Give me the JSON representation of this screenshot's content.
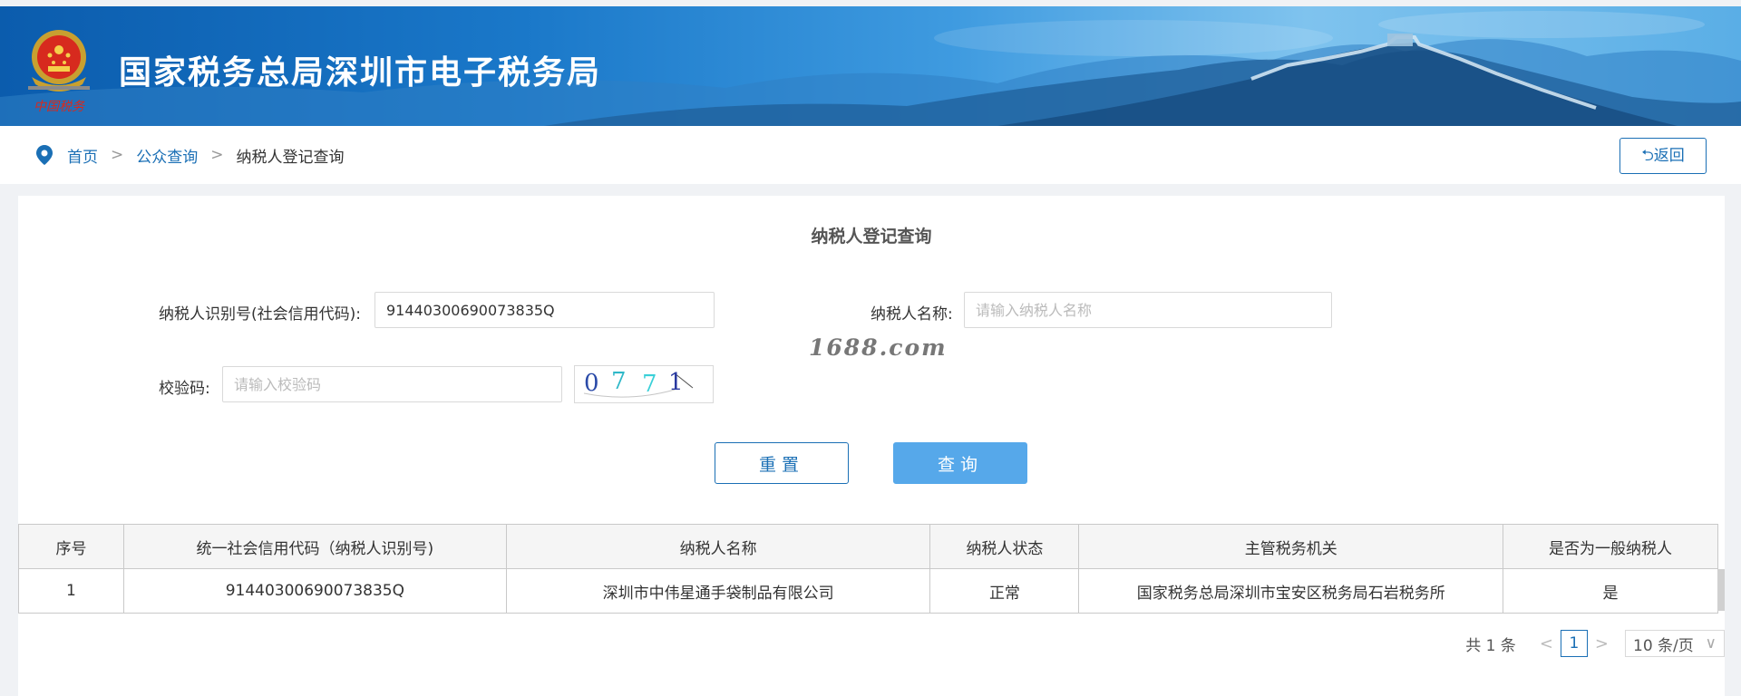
{
  "header": {
    "site_title": "国家税务总局深圳市电子税务局",
    "emblem_text": "中国税务",
    "colors": {
      "banner_dark": "#0b5cad",
      "banner_light": "#7fc3ee"
    }
  },
  "breadcrumb": {
    "items": [
      "首页",
      "公众查询",
      "纳税人登记查询"
    ],
    "separator": ">",
    "back_label": "⮌返回"
  },
  "form": {
    "title": "纳税人登记查询",
    "taxpayer_id_label": "纳税人识别号(社会信用代码):",
    "taxpayer_id_value": "91440300690073835Q",
    "taxpayer_name_label": "纳税人名称:",
    "taxpayer_name_placeholder": "请输入纳税人名称",
    "captcha_label": "校验码:",
    "captcha_placeholder": "请输入校验码",
    "captcha_chars": [
      "0",
      "7",
      "7",
      "1"
    ],
    "reset_label": "重置",
    "query_label": "查询"
  },
  "watermark": "1688.com",
  "table": {
    "headers": [
      "序号",
      "统一社会信用代码（纳税人识别号)",
      "纳税人名称",
      "纳税人状态",
      "主管税务机关",
      "是否为一般纳税人"
    ],
    "rows": [
      [
        "1",
        "91440300690073835Q",
        "深圳市中伟星通手袋制品有限公司",
        "正常",
        "国家税务总局深圳市宝安区税务局石岩税务所",
        "是"
      ]
    ]
  },
  "pagination": {
    "total": "共 1 条",
    "prev": "<",
    "current": "1",
    "next": ">",
    "page_size": "10 条/页",
    "page_size_arrow": "∨"
  },
  "accent_color": "#1a6fb5",
  "button_blue": "#56a8ea"
}
